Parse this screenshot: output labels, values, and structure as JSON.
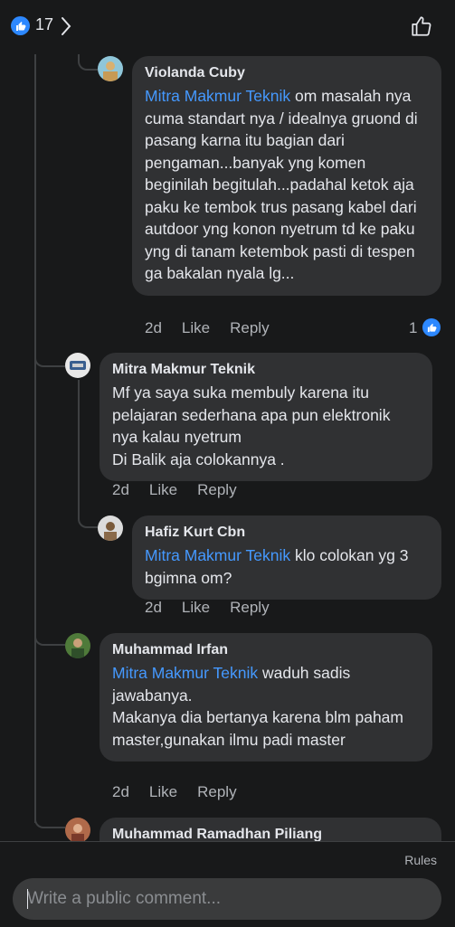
{
  "header": {
    "reaction_count": "17"
  },
  "comments": [
    {
      "author": "Violanda Cuby",
      "mention": "Mitra Makmur Teknik",
      "text": " om masalah nya cuma standart nya / idealnya gruond di pasang karna itu bagian dari pengaman...banyak yng komen beginilah begitulah...padahal ketok aja paku ke tembok trus pasang kabel dari autdoor yng konon nyetrum td ke paku yng di tanam ketembok pasti di tespen ga bakalan nyala lg...",
      "time": "2d",
      "like": "Like",
      "reply": "Reply",
      "reactions": "1"
    },
    {
      "author": "Mitra Makmur Teknik",
      "mention": "",
      "text": "Mf ya saya suka membuly karena itu pelajaran sederhana apa pun elektronik nya kalau nyetrum\nDi Balik aja colokannya .",
      "time": "2d",
      "like": "Like",
      "reply": "Reply"
    },
    {
      "author": "Hafiz Kurt Cbn",
      "mention": "Mitra Makmur Teknik",
      "text": " klo colokan yg 3 bgimna om?",
      "time": "2d",
      "like": "Like",
      "reply": "Reply"
    },
    {
      "author": "Muhammad Irfan",
      "mention": "Mitra Makmur Teknik",
      "text": " waduh sadis jawabanya.\nMakanya dia bertanya karena blm paham master,gunakan ilmu padi master",
      "time": "2d",
      "like": "Like",
      "reply": "Reply"
    },
    {
      "author": "Muhammad Ramadhan Piliang"
    }
  ],
  "footer": {
    "rules": "Rules",
    "placeholder": "Write a public comment..."
  },
  "colors": {
    "accent": "#2d88ff",
    "mention": "#4599ff",
    "bubble": "#303133",
    "background": "#18191a"
  }
}
